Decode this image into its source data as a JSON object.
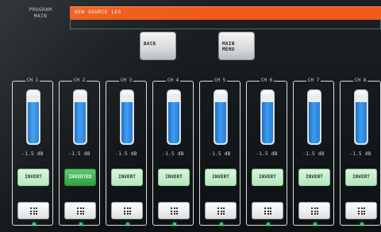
{
  "header": {
    "program_label_line1": "PROGRAM",
    "program_label_line2": "MAIN",
    "source_title": "NEW SOURCE LES"
  },
  "buttons": {
    "back_label": "BACK",
    "main_menu_line1": "MAIN",
    "main_menu_line2": "MENU"
  },
  "channels": [
    {
      "title": "CH 1",
      "level": "-1.5 dB",
      "invert_label": "INVERT",
      "inverted": false,
      "fader_fraction": 0.88,
      "status_led": "on"
    },
    {
      "title": "CH 2",
      "level": "-1.5 dB",
      "invert_label": "INVERTED",
      "inverted": true,
      "fader_fraction": 0.88,
      "status_led": "on"
    },
    {
      "title": "CH 3",
      "level": "-1.5 dB",
      "invert_label": "INVERT",
      "inverted": false,
      "fader_fraction": 0.88,
      "status_led": "on"
    },
    {
      "title": "CH 4",
      "level": "-1.5 dB",
      "invert_label": "INVERT",
      "inverted": false,
      "fader_fraction": 0.88,
      "status_led": "on"
    },
    {
      "title": "CH 5",
      "level": "-1.5 dB",
      "invert_label": "INVERT",
      "inverted": false,
      "fader_fraction": 0.88,
      "status_led": "on"
    },
    {
      "title": "CH 6",
      "level": "-1.5 dB",
      "invert_label": "INVERT",
      "inverted": false,
      "fader_fraction": 0.88,
      "status_led": "on"
    },
    {
      "title": "CH 7",
      "level": "-1.5 dB",
      "invert_label": "INVERT",
      "inverted": false,
      "fader_fraction": 0.88,
      "status_led": "on"
    },
    {
      "title": "CH 8",
      "level": "-1.5 dB",
      "invert_label": "INVERT",
      "inverted": false,
      "fader_fraction": 0.88,
      "status_led": "on"
    }
  ],
  "icons": {
    "channel_menu_icon": "grid-icon",
    "status_icon": "led-icon"
  },
  "colors": {
    "source_bar": "#f05a1a",
    "fader_blue": "#2f8ae6",
    "invert_idle": "#b7e6bf",
    "invert_active": "#2f9c43",
    "led_green": "#2edc5b"
  }
}
